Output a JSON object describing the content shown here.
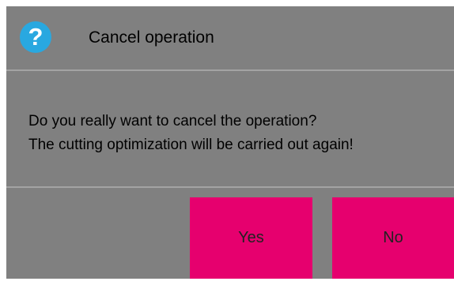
{
  "dialog": {
    "title": "Cancel operation",
    "title_icon": "question-mark-icon",
    "title_icon_glyph": "?",
    "message_lines": [
      "Do you really want to cancel the operation?",
      "The cutting optimization will be carried out again!"
    ],
    "buttons": {
      "yes_label": "Yes",
      "no_label": "No"
    }
  },
  "colors": {
    "background": "#808080",
    "accent_button": "#e6006e",
    "icon_blue": "#29a8e0",
    "divider": "#a3a3a3"
  }
}
